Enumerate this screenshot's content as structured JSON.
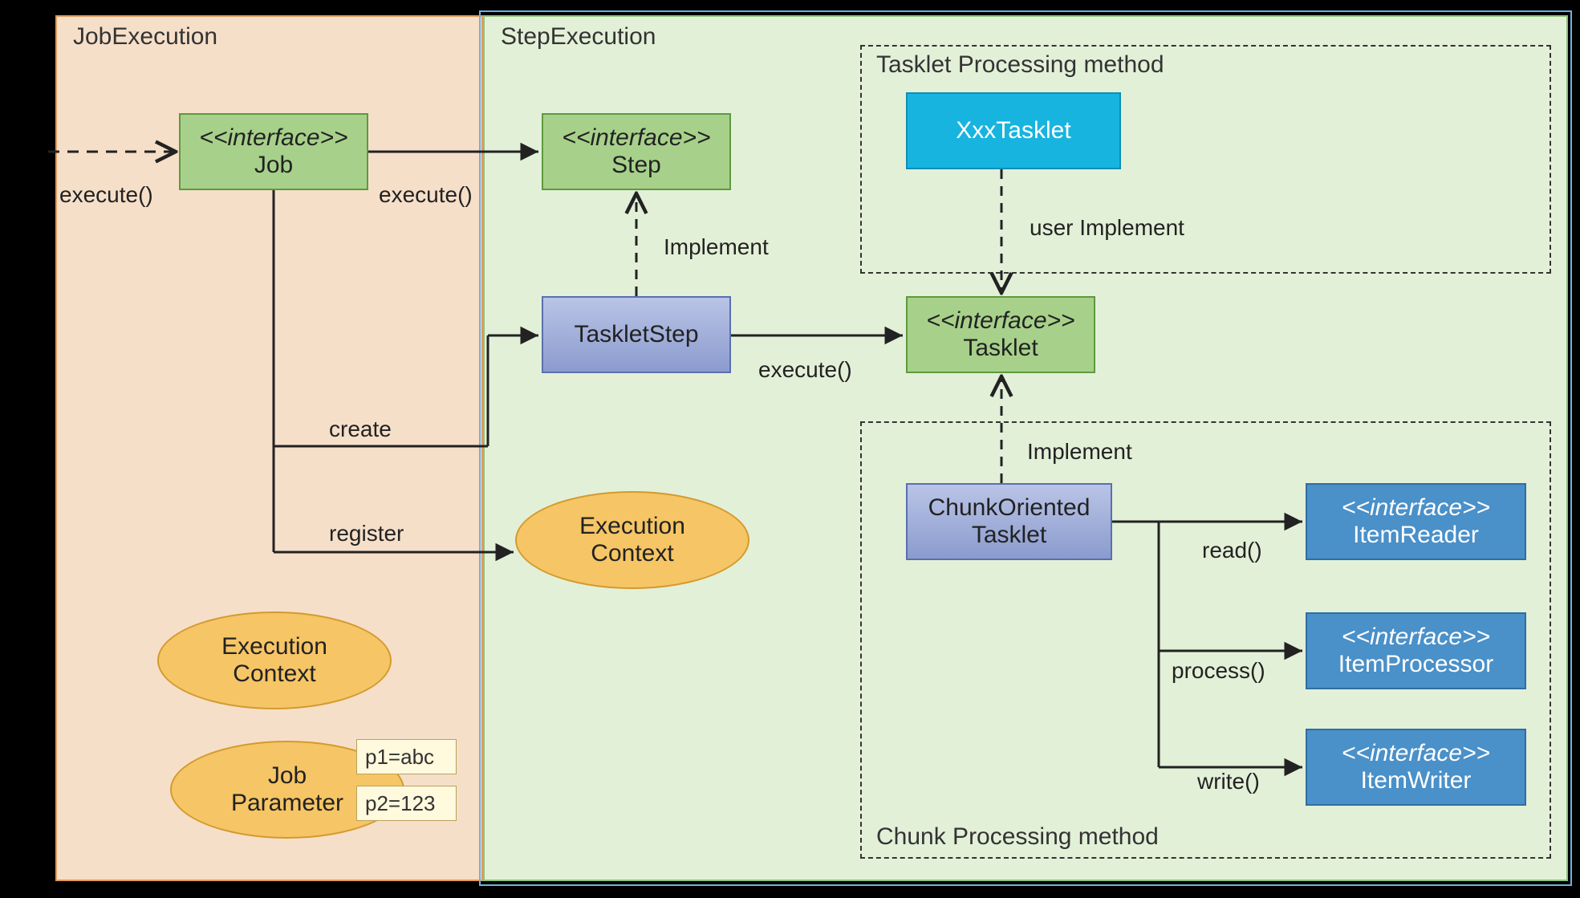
{
  "regions": {
    "jobExecution": {
      "title": "JobExecution"
    },
    "stepExecution": {
      "title": "StepExecution"
    },
    "taskletMethod": {
      "title": "Tasklet Processing method"
    },
    "chunkMethod": {
      "title": "Chunk Processing method"
    }
  },
  "boxes": {
    "job": {
      "stereo": "<<interface>>",
      "name": "Job"
    },
    "step": {
      "stereo": "<<interface>>",
      "name": "Step"
    },
    "taskletStep": {
      "name": "TaskletStep"
    },
    "tasklet": {
      "stereo": "<<interface>>",
      "name": "Tasklet"
    },
    "xxxTasklet": {
      "name": "XxxTasklet"
    },
    "chunkTasklet": {
      "line1": "ChunkOriented",
      "line2": "Tasklet"
    },
    "itemReader": {
      "stereo": "<<interface>>",
      "name": "ItemReader"
    },
    "itemProcessor": {
      "stereo": "<<interface>>",
      "name": "ItemProcessor"
    },
    "itemWriter": {
      "stereo": "<<interface>>",
      "name": "ItemWriter"
    },
    "execCtx1": {
      "line1": "Execution",
      "line2": "Context"
    },
    "execCtx2": {
      "line1": "Execution",
      "line2": "Context"
    },
    "jobParam": {
      "line1": "Job",
      "line2": "Parameter"
    }
  },
  "notes": {
    "p1": "p1=abc",
    "p2": "p2=123"
  },
  "labels": {
    "execute1": "execute()",
    "execute2": "execute()",
    "execute3": "execute()",
    "create": "create",
    "register": "register",
    "implement1": "Implement",
    "implement2": "Implement",
    "userImplement": "user Implement",
    "read": "read()",
    "process": "process()",
    "write": "write()"
  },
  "colors": {
    "jobExecBg": "#f6dfc9",
    "jobExecBorder": "#e09a5a",
    "stepExecBg": "#e3f0d8",
    "stepExecBorder": "#8fc17a",
    "stepExecOuter": "#6fb0e0",
    "greenBoxBg": "#a7d18a",
    "greenBoxBorder": "#5d9a3d",
    "blueBoxBg": "#9aa8d8",
    "blueBoxBorder": "#5a6fb0",
    "cyanBoxBg": "#17b4e0",
    "cyanBoxBorder": "#0e8fb5",
    "darkBlueBg": "#4a90c9",
    "darkBlueBorder": "#2f6ea3",
    "ellipseBg": "#f6c565",
    "ellipseBorder": "#d39a2e"
  }
}
